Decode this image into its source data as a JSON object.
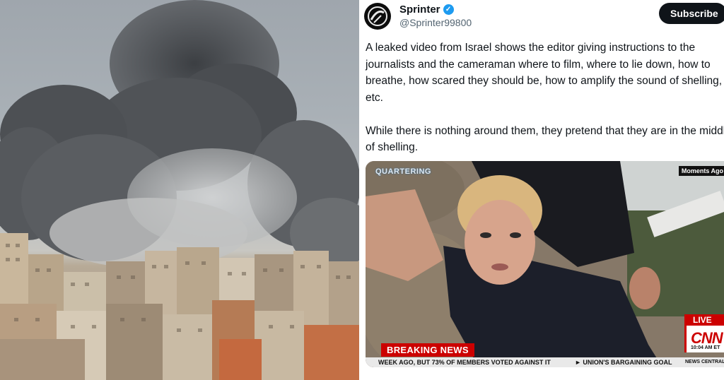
{
  "tweet": {
    "author_name": "Sprinter",
    "author_handle": "@Sprinter99800",
    "verified_mark": "✓",
    "subscribe_label": "Subscribe",
    "paragraph_1": "A leaked video from Israel shows the editor giving instructions to the journalists and the cameraman where to film, where to lie down, how to breathe, how scared they should be, how to amplify the sound of shelling, etc.",
    "paragraph_2": "While there is nothing around them, they pretend that they are in the middle of shelling."
  },
  "video": {
    "watermark": "QUARTERING",
    "corner_label": "Moments Ago",
    "breaking_label": "BREAKING NEWS",
    "ticker_left": "WEEK AGO, BUT 73% OF MEMBERS VOTED AGAINST IT",
    "ticker_right": "► UNION'S BARGAINING GOAL",
    "ticker_tag": "NEWS CENTRAL",
    "live_label": "LIVE",
    "network_logo": "CNN",
    "network_time": "10:04 AM ET"
  },
  "colors": {
    "accent_blue": "#1d9bf0",
    "text_primary": "#0f1419",
    "text_secondary": "#536471",
    "breaking_red": "#cc0000"
  },
  "icons": [
    "verified-badge-icon",
    "avatar-logo-icon"
  ]
}
